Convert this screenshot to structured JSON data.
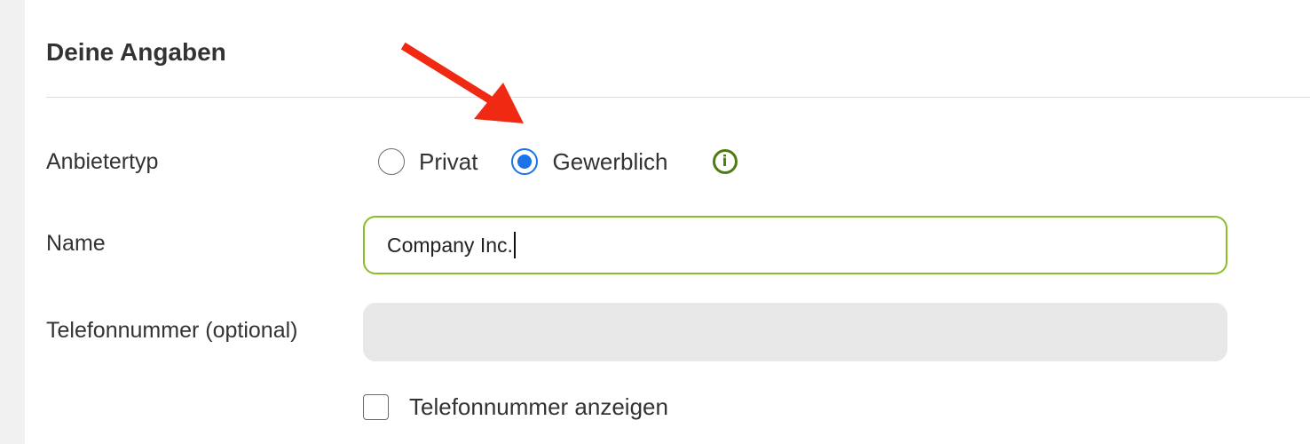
{
  "section": {
    "title": "Deine Angaben"
  },
  "provider_type": {
    "label": "Anbietertyp",
    "options": [
      {
        "label": "Privat",
        "selected": false
      },
      {
        "label": "Gewerblich",
        "selected": true
      }
    ],
    "info_icon": "info-icon"
  },
  "name_field": {
    "label": "Name",
    "value": "Company Inc."
  },
  "phone_field": {
    "label": "Telefonnummer (optional)",
    "value": ""
  },
  "show_phone": {
    "label": "Telefonnummer anzeigen",
    "checked": false
  },
  "colors": {
    "accent_blue": "#1a73e8",
    "input_focus_green": "#8bbd2b",
    "info_green": "#4f7c12",
    "annotation_red": "#f02a12",
    "disabled_input": "#e8e8e8"
  }
}
